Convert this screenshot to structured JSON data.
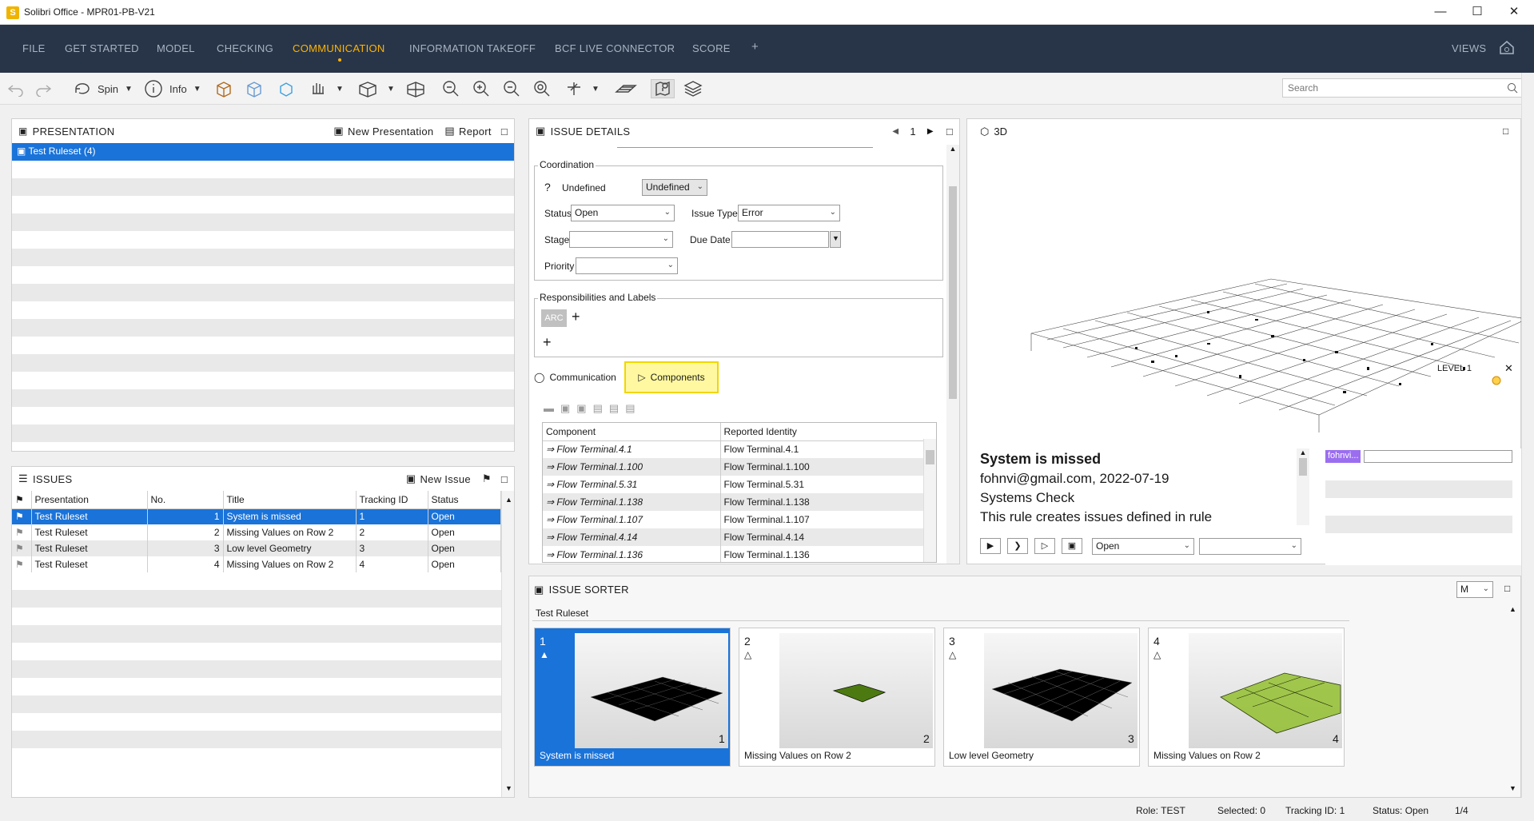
{
  "window": {
    "title": "Solibri Office - MPR01-PB-V21",
    "app_icon": "S"
  },
  "menu": {
    "items": [
      "FILE",
      "GET STARTED",
      "MODEL",
      "CHECKING",
      "COMMUNICATION",
      "INFORMATION TAKEOFF",
      "BCF LIVE CONNECTOR",
      "SCORE",
      "+"
    ],
    "active": "COMMUNICATION",
    "views_label": "VIEWS"
  },
  "toolbar": {
    "spin_label": "Spin",
    "info_label": "Info",
    "search_placeholder": "Search"
  },
  "presentation": {
    "title": "PRESENTATION",
    "new_label": "New Presentation",
    "report_label": "Report",
    "items": [
      "Test Ruleset (4)"
    ]
  },
  "issues": {
    "title": "ISSUES",
    "new_label": "New Issue",
    "columns": [
      "Presentation",
      "No.",
      "Title",
      "Tracking ID",
      "Status"
    ],
    "rows": [
      [
        "Test Ruleset",
        "1",
        "System is missed",
        "1",
        "Open"
      ],
      [
        "Test Ruleset",
        "2",
        "Missing Values on Row 2",
        "2",
        "Open"
      ],
      [
        "Test Ruleset",
        "3",
        "Low level Geometry",
        "3",
        "Open"
      ],
      [
        "Test Ruleset",
        "4",
        "Missing Values on Row 2",
        "4",
        "Open"
      ]
    ]
  },
  "issue_details": {
    "title": "ISSUE DETAILS",
    "page": "1",
    "coordination_label": "Coordination",
    "coordination_mark": "?",
    "undefined_label": "Undefined",
    "undefined_value": "Undefined",
    "status_label": "Status",
    "status_value": "Open",
    "issue_type_label": "Issue Type",
    "issue_type_value": "Error",
    "stage_label": "Stage",
    "due_date_label": "Due Date",
    "priority_label": "Priority",
    "responsibilities_label": "Responsibilities and Labels",
    "arc_tag": "ARC",
    "tab_communication": "Communication",
    "tab_components": "Components",
    "component_columns": [
      "Component",
      "Reported Identity"
    ],
    "components": [
      [
        "Flow Terminal.4.1",
        "Flow Terminal.4.1"
      ],
      [
        "Flow Terminal.1.100",
        "Flow Terminal.1.100"
      ],
      [
        "Flow Terminal.5.31",
        "Flow Terminal.5.31"
      ],
      [
        "Flow Terminal.1.138",
        "Flow Terminal.1.138"
      ],
      [
        "Flow Terminal.1.107",
        "Flow Terminal.1.107"
      ],
      [
        "Flow Terminal.4.14",
        "Flow Terminal.4.14"
      ],
      [
        "Flow Terminal.1.136",
        "Flow Terminal.1.136"
      ]
    ]
  },
  "view3d": {
    "title": "3D",
    "level_label": "LEVEL 1",
    "issue_title": "System is missed",
    "issue_meta": "fohnvi@gmail.com, 2022-07-19",
    "issue_category": "Systems Check",
    "issue_desc": "This rule creates issues defined in rule",
    "user_tag": "fohnvi...",
    "status_select": "Open"
  },
  "sorter": {
    "title": "ISSUE SORTER",
    "size_select": "M",
    "group_label": "Test Ruleset",
    "cards": [
      {
        "num": "1",
        "caption": "System is missed"
      },
      {
        "num": "2",
        "caption": "Missing Values on Row 2"
      },
      {
        "num": "3",
        "caption": "Low level Geometry"
      },
      {
        "num": "4",
        "caption": "Missing Values on Row 2"
      }
    ]
  },
  "status": {
    "role": "Role: TEST",
    "selected": "Selected: 0",
    "tracking": "Tracking ID: 1",
    "status": "Status: Open",
    "count": "1/4"
  },
  "colors": {
    "menu_bg": "#283548",
    "accent": "#ffb400",
    "selection": "#1a73d9"
  }
}
